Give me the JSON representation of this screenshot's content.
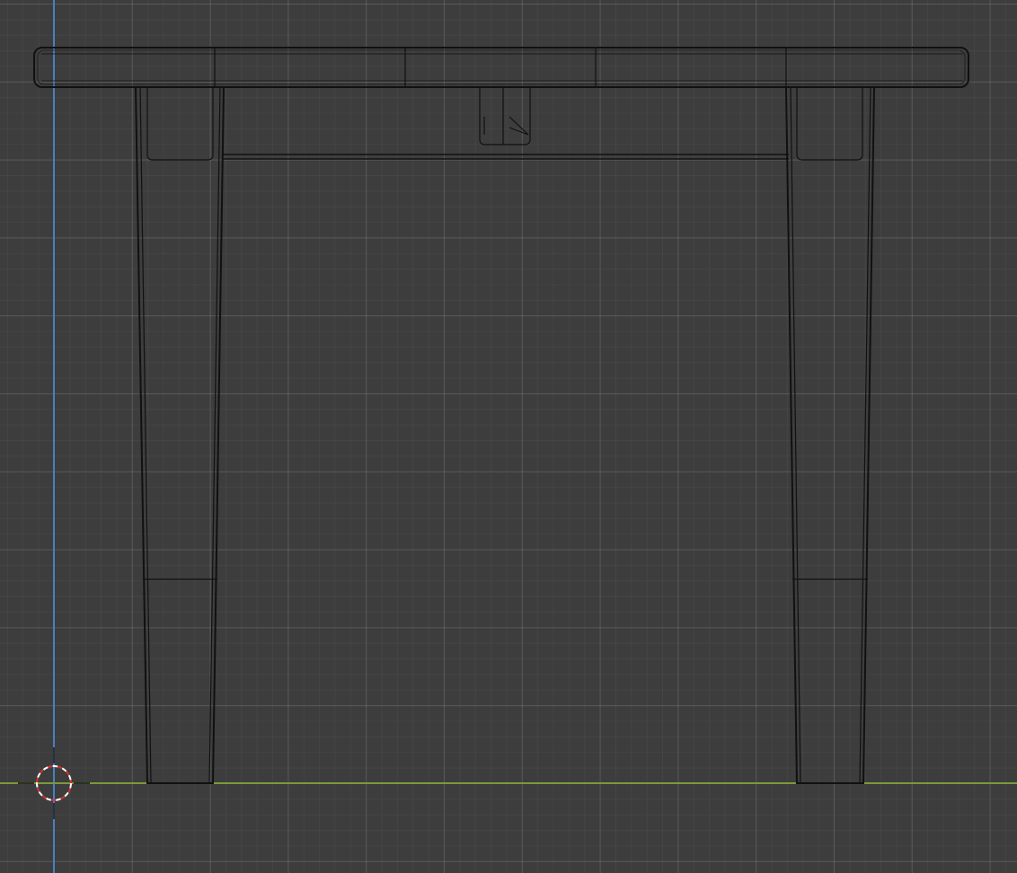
{
  "viewport": {
    "background_color": "#3d3d3d",
    "grid_minor_color": "#444444",
    "grid_major_color": "#525252",
    "z_axis_color": "#4a7fc1",
    "x_axis_color": "#7a9a3a",
    "wire_color": "#111111",
    "cursor_colors": [
      "#ff4040",
      "#ffffff"
    ]
  },
  "objects": [
    {
      "name": "table_top",
      "type": "mesh",
      "display": "wireframe"
    },
    {
      "name": "apron",
      "type": "mesh",
      "display": "wireframe"
    },
    {
      "name": "leg_left",
      "type": "mesh",
      "display": "wireframe"
    },
    {
      "name": "leg_right",
      "type": "mesh",
      "display": "wireframe"
    },
    {
      "name": "drawer_handle",
      "type": "mesh",
      "display": "wireframe"
    }
  ],
  "cursor": {
    "icon": "3d-cursor-icon"
  }
}
